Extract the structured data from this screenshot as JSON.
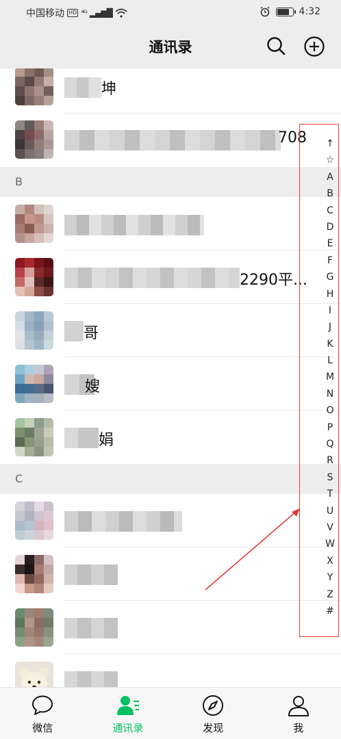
{
  "status_bar": {
    "carrier": "中国移动",
    "hd": "HD",
    "network": "⁴ᴳ",
    "signal": "▂▄▆█",
    "wifi": "WiFi",
    "time": "4:32",
    "battery_level": 0.85
  },
  "header": {
    "title": "通讯录",
    "search_icon": "search-icon",
    "add_icon": "plus-circle-icon"
  },
  "sections": [
    {
      "letter": "B"
    },
    {
      "letter": "C"
    }
  ],
  "contacts": [
    {
      "visible_name": "坤",
      "avatar_icon": "blurred-avatar"
    },
    {
      "visible_name": "708",
      "avatar_icon": "blurred-avatar"
    },
    {
      "visible_name": "",
      "avatar_icon": "blurred-avatar"
    },
    {
      "visible_name": "2290平...",
      "avatar_icon": "blurred-avatar"
    },
    {
      "visible_name": "哥",
      "avatar_icon": "blurred-avatar"
    },
    {
      "visible_name": "嫂",
      "avatar_icon": "blurred-avatar"
    },
    {
      "visible_name": "娟",
      "avatar_icon": "blurred-avatar"
    },
    {
      "visible_name": "",
      "avatar_icon": "blurred-avatar"
    },
    {
      "visible_name": "",
      "avatar_icon": "blurred-avatar"
    },
    {
      "visible_name": "",
      "avatar_icon": "blurred-avatar"
    },
    {
      "visible_name": "",
      "avatar_icon": "bear-avatar"
    }
  ],
  "index_bar": [
    "↑",
    "☆",
    "A",
    "B",
    "C",
    "D",
    "E",
    "F",
    "G",
    "H",
    "I",
    "J",
    "K",
    "L",
    "M",
    "N",
    "O",
    "P",
    "Q",
    "R",
    "S",
    "T",
    "U",
    "V",
    "W",
    "X",
    "Y",
    "Z",
    "#"
  ],
  "annotation_color": "#e53935",
  "accent_color": "#07c160",
  "bottom_nav": [
    {
      "label": "微信",
      "icon": "chat-bubble-icon",
      "active": false
    },
    {
      "label": "通讯录",
      "icon": "contacts-icon",
      "active": true
    },
    {
      "label": "发现",
      "icon": "compass-icon",
      "active": false
    },
    {
      "label": "我",
      "icon": "person-icon",
      "active": false
    }
  ]
}
